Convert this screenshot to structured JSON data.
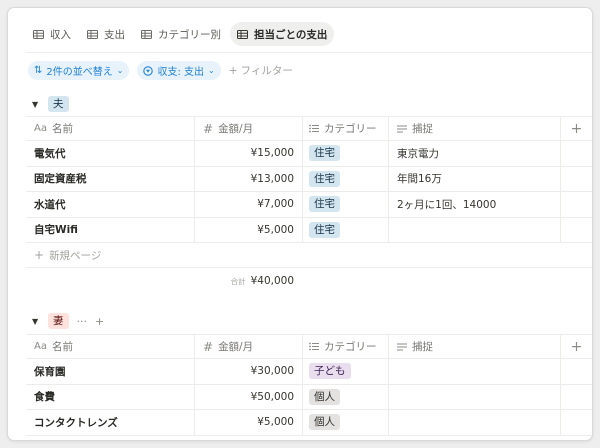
{
  "tabs": [
    {
      "label": "収入",
      "active": false
    },
    {
      "label": "支出",
      "active": false
    },
    {
      "label": "カテゴリー別",
      "active": false
    },
    {
      "label": "担当ごとの支出",
      "active": true
    }
  ],
  "toolbar": {
    "sort_label": "2件の並べ替え",
    "filter_label": "収支: 支出",
    "add_filter_label": "フィルター"
  },
  "columns": {
    "name": "名前",
    "amount": "金額/月",
    "category": "カテゴリー",
    "memo": "捕捉",
    "name_icon": "Aa"
  },
  "groups": [
    {
      "label": "夫",
      "rows": [
        {
          "name": "電気代",
          "amount": "¥15,000",
          "category": "住宅",
          "memo": "東京電力"
        },
        {
          "name": "固定資産税",
          "amount": "¥13,000",
          "category": "住宅",
          "memo": "年間16万"
        },
        {
          "name": "水道代",
          "amount": "¥7,000",
          "category": "住宅",
          "memo": "2ヶ月に1回、14000"
        },
        {
          "name": "自宅Wifi",
          "amount": "¥5,000",
          "category": "住宅",
          "memo": ""
        }
      ],
      "new_row_label": "新規ページ",
      "sum_label": "合計",
      "sum_value": "¥40,000"
    },
    {
      "label": "妻",
      "more_icon": "···",
      "add_icon": "+",
      "rows": [
        {
          "name": "保育園",
          "amount": "¥30,000",
          "category": "子ども",
          "memo": ""
        },
        {
          "name": "食費",
          "amount": "¥50,000",
          "category": "個人",
          "memo": ""
        },
        {
          "name": "コンタクトレンズ",
          "amount": "¥5,000",
          "category": "個人",
          "memo": ""
        }
      ]
    }
  ],
  "icons": {
    "tab": "table-icon",
    "sort": "sort-arrows-icon",
    "filter": "filter-circle-icon",
    "amount": "hash-icon",
    "category": "list-icon",
    "memo": "text-lines-icon"
  },
  "colors": {
    "accent": "#2382d6",
    "tag_house": "#d3e5ef",
    "tag_child": "#e8deee",
    "tag_personal": "#e3e2e0",
    "tag_husband": "#d3e5ef",
    "tag_wife": "#ffe2dd"
  }
}
